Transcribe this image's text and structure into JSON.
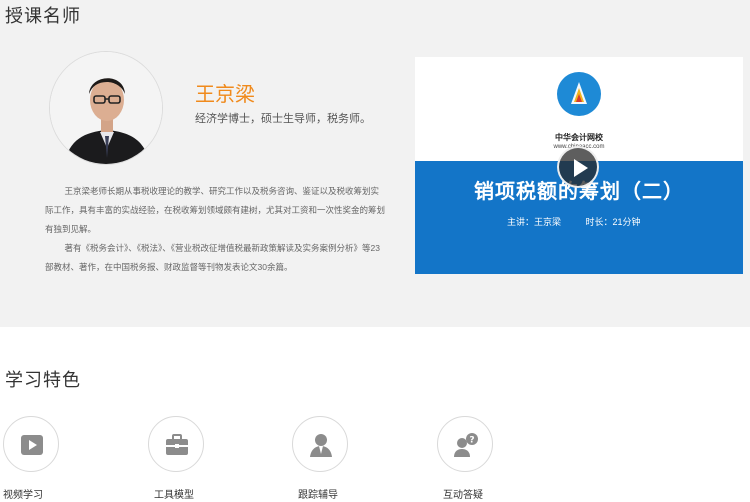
{
  "teacher_section": {
    "title": "授课名师",
    "name": "王京梁",
    "credentials": "经济学博士，硕士生导师，税务师。",
    "bio": [
      "王京梁老师长期从事税收理论的教学、研究工作以及税务咨询、鉴证以及税收筹划实际工作，具有丰富的实战经验，在税收筹划领域颇有建树，尤其对工资和一次性奖金的筹划有独到见解。",
      "著有《税务会计》、《税法》、《营业税改征增值税最新政策解读及实务案例分析》等23部教材、著作，在中国税务报、财政监督等刊物发表论文30余篇。"
    ]
  },
  "video": {
    "brand": "中华会计网校",
    "url": "www.chinaacc.com",
    "title": "销项税额的筹划（二）",
    "speaker": "主讲：王京梁",
    "duration": "时长：21分钟",
    "icons": {
      "play": "play-icon",
      "logo": "chinaacc-logo-icon"
    }
  },
  "features_section": {
    "title": "学习特色",
    "items": [
      {
        "label": "视频学习",
        "icon": "video-icon"
      },
      {
        "label": "工具模型",
        "icon": "toolbox-icon"
      },
      {
        "label": "跟踪辅导",
        "icon": "tutor-icon"
      },
      {
        "label": "互动答疑",
        "icon": "qa-icon"
      }
    ]
  },
  "colors": {
    "name_accent": "#f08a1c",
    "video_blue": "#1375c8",
    "section_bg": "#f2f2f2",
    "icon_gray": "#8c8c8c"
  }
}
